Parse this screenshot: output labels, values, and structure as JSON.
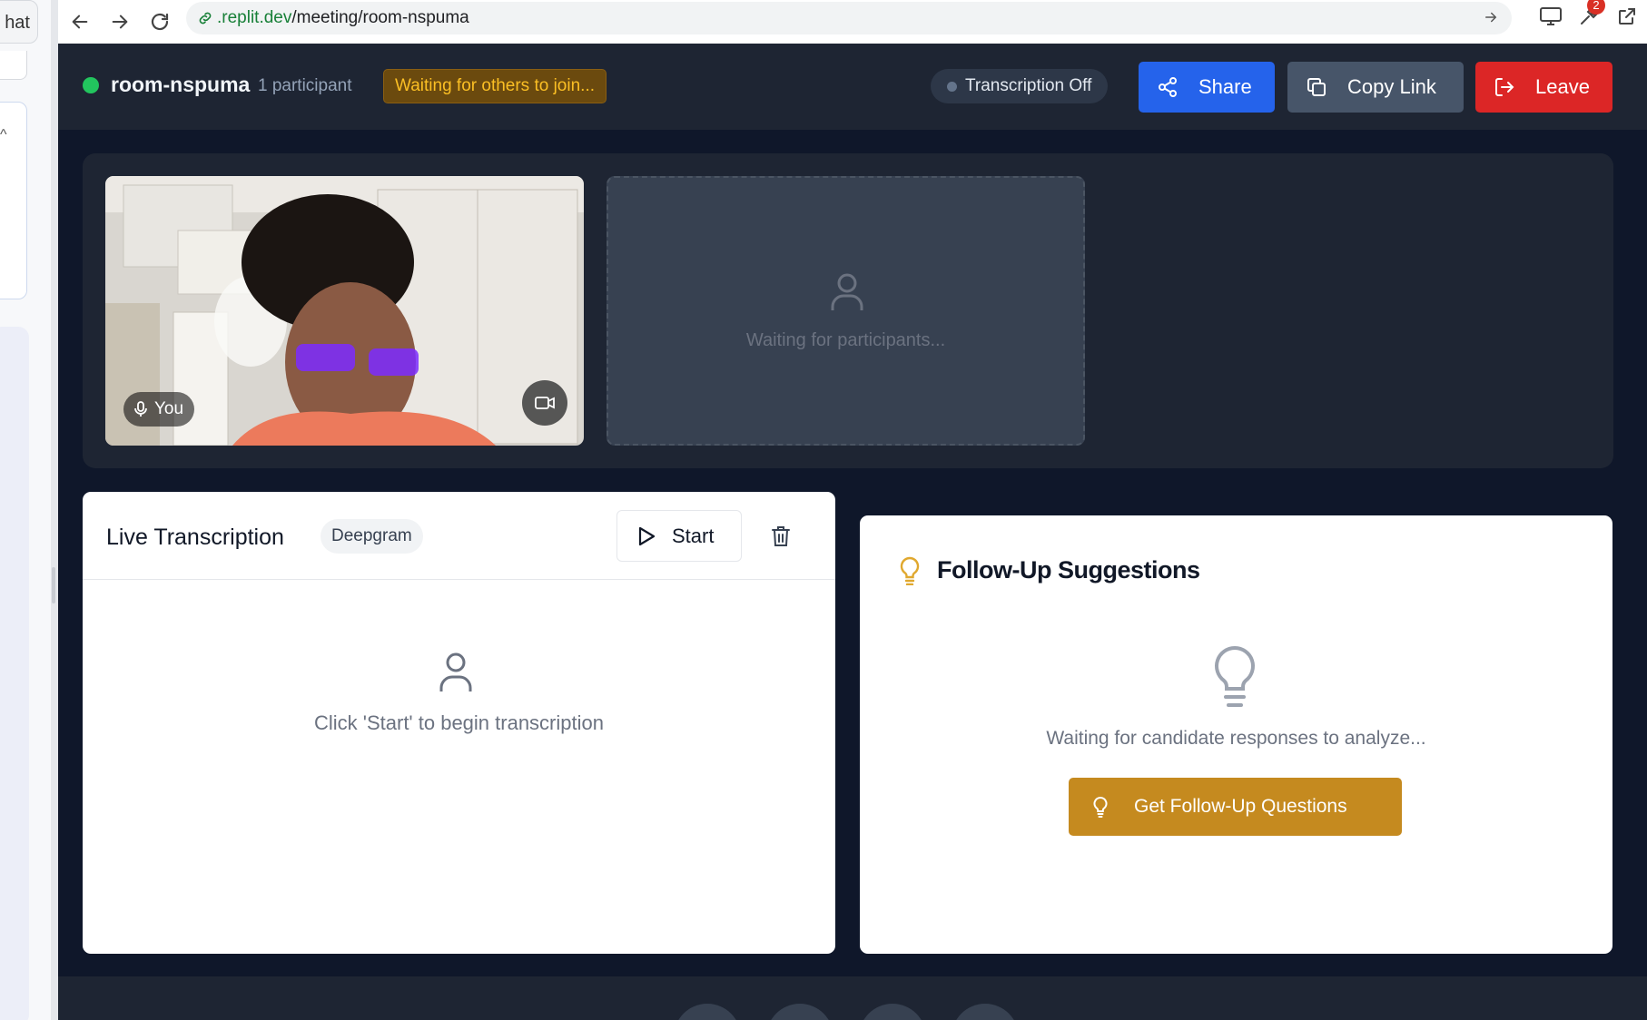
{
  "sidebar": {
    "tab_label": "hat",
    "caret": "^"
  },
  "browser": {
    "url_domain": ".replit.dev",
    "url_path": "/meeting/room-nspuma",
    "extension_badge_count": "2"
  },
  "header": {
    "room_name": "room-nspuma",
    "participants": "1 participant",
    "waiting_badge": "Waiting for others to join...",
    "transcription_status": "Transcription Off",
    "share_label": "Share",
    "copy_link_label": "Copy Link",
    "leave_label": "Leave",
    "colors": {
      "live": "#22c55e",
      "share": "#2563eb",
      "copy": "#475569",
      "leave": "#dc2626"
    }
  },
  "video": {
    "self_label": "You",
    "waiting_message": "Waiting for participants..."
  },
  "transcription": {
    "title": "Live Transcription",
    "provider_badge": "Deepgram",
    "start_label": "Start",
    "empty_message": "Click 'Start' to begin transcription"
  },
  "followup": {
    "title": "Follow-Up Suggestions",
    "empty_message": "Waiting for candidate responses to analyze...",
    "button_label": "Get Follow-Up Questions",
    "accent": "#c58a1f"
  },
  "icons": {
    "back": "arrow-left-icon",
    "forward": "arrow-right-icon",
    "reload": "reload-icon",
    "link": "link-icon",
    "share": "share-icon",
    "copy": "copy-icon",
    "leave": "logout-icon",
    "mic": "mic-icon",
    "camera": "video-icon",
    "person": "user-icon",
    "play": "play-icon",
    "trash": "trash-icon",
    "bulb": "lightbulb-icon"
  }
}
